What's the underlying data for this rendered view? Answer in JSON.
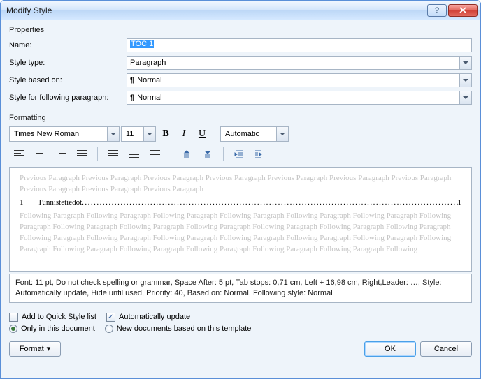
{
  "window": {
    "title": "Modify Style"
  },
  "groups": {
    "properties": "Properties",
    "formatting": "Formatting"
  },
  "properties": {
    "name_label": "Name:",
    "name_value": "TOC 1",
    "type_label": "Style type:",
    "type_value": "Paragraph",
    "based_label": "Style based on:",
    "based_value": "Normal",
    "following_label": "Style for following paragraph:",
    "following_value": "Normal"
  },
  "formatting": {
    "font": "Times New Roman",
    "size": "11",
    "color": "Automatic"
  },
  "preview": {
    "prev": "Previous Paragraph Previous Paragraph Previous Paragraph Previous Paragraph Previous Paragraph Previous Paragraph Previous Paragraph Previous Paragraph Previous Paragraph Previous Paragraph",
    "sample_num": "1",
    "sample_text": "Tunnistetiedot",
    "sample_page": "1",
    "next": "Following Paragraph Following Paragraph Following Paragraph Following Paragraph Following Paragraph Following Paragraph Following Paragraph Following Paragraph Following Paragraph Following Paragraph Following Paragraph Following Paragraph Following Paragraph Following Paragraph Following Paragraph Following Paragraph Following Paragraph Following Paragraph Following Paragraph Following Paragraph Following Paragraph Following Paragraph Following Paragraph Following Paragraph Following Paragraph Following"
  },
  "description": "Font: 11 pt, Do not check spelling or grammar, Space After:  5 pt, Tab stops:  0,71 cm, Left +  16,98 cm, Right,Leader: …, Style: Automatically update, Hide until used, Priority: 40, Based on: Normal, Following style: Normal",
  "options": {
    "add_quick": "Add to Quick Style list",
    "auto_update": "Automatically update",
    "only_doc": "Only in this document",
    "new_docs": "New documents based on this template"
  },
  "buttons": {
    "format": "Format",
    "ok": "OK",
    "cancel": "Cancel"
  }
}
